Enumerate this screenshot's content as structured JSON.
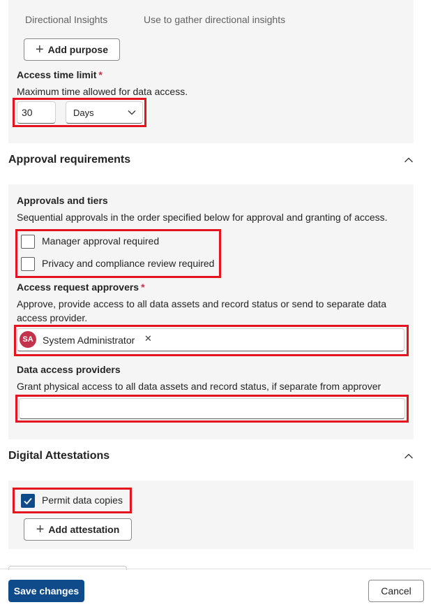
{
  "purposes": {
    "row": {
      "name": "Directional Insights",
      "description": "Use to gather directional insights"
    },
    "add_purpose_label": "Add purpose"
  },
  "access_time": {
    "label": "Access time limit",
    "required_marker": "*",
    "description": "Maximum time allowed for data access.",
    "value": "30",
    "unit": "Days"
  },
  "approval": {
    "section_title": "Approval requirements",
    "tiers_label": "Approvals and tiers",
    "tiers_description": "Sequential approvals in the order specified below for approval and granting of access.",
    "manager_label": "Manager approval required",
    "manager_checked": false,
    "privacy_label": "Privacy and compliance review required",
    "privacy_checked": false,
    "approvers_label": "Access request approvers",
    "approvers_required_marker": "*",
    "approvers_description_line1": "Approve, provide access to all data assets and record status or send to separate data",
    "approvers_description_line2": "access provider.",
    "approver_initials": "SA",
    "approver_name": "System Administrator",
    "remove_glyph": "✕",
    "providers_label": "Data access providers",
    "providers_description": "Grant physical access to all data assets and record status, if separate from approver",
    "providers_value": ""
  },
  "attestations": {
    "section_title": "Digital Attestations",
    "permit_copies_label": "Permit data copies",
    "permit_copies_checked": true,
    "add_attestation_label": "Add attestation"
  },
  "footer": {
    "save_label": "Save changes",
    "cancel_label": "Cancel"
  },
  "colors": {
    "primary": "#0f4a8a",
    "highlight_box": "#e3141f",
    "required_marker": "#c4314b",
    "avatar": "#c4314b",
    "panel_bg": "#f5f5f5"
  },
  "icons": {
    "add": "plus-icon",
    "dropdown": "chevron-down-icon",
    "collapse": "chevron-up-icon",
    "check": "checkmark-icon",
    "remove": "dismiss-icon"
  }
}
